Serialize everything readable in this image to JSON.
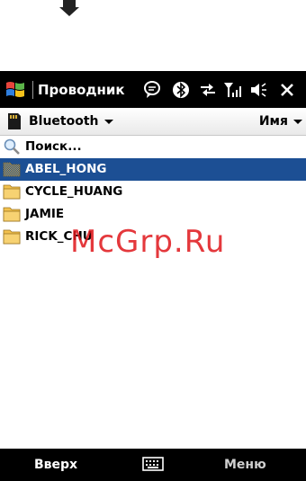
{
  "titlebar": {
    "title": "Проводник"
  },
  "location": {
    "folder": "Bluetooth",
    "sort": "Имя"
  },
  "search": {
    "label": "Поиск..."
  },
  "files": [
    {
      "name": "ABEL_HONG",
      "selected": true
    },
    {
      "name": "CYCLE_HUANG",
      "selected": false
    },
    {
      "name": "JAMIE",
      "selected": false
    },
    {
      "name": "RICK_CHU",
      "selected": false
    }
  ],
  "softkeys": {
    "left": "Вверх",
    "right": "Меню"
  },
  "watermark": "McGrp.Ru",
  "colors": {
    "selection": "#1c4f94",
    "folder": "#f2c14e",
    "watermark": "#e0161b"
  }
}
